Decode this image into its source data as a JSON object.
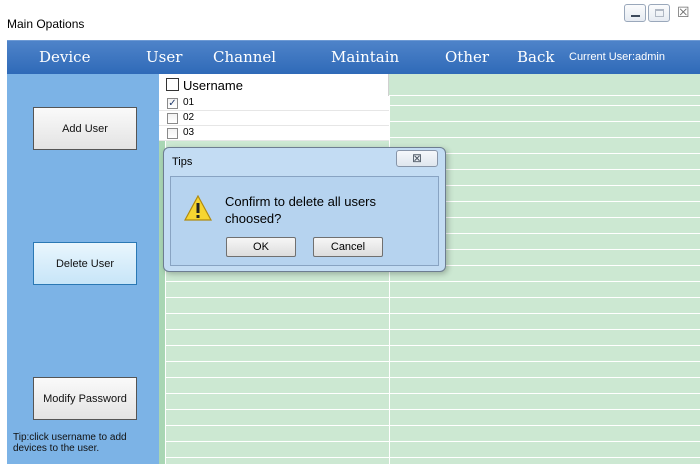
{
  "window": {
    "title": "Main Opations",
    "controls": {
      "minimize": "minimize-icon",
      "maximize": "maximize-icon",
      "close": "close-icon"
    }
  },
  "menu": {
    "items": [
      "Device",
      "User",
      "Channel",
      "Maintain",
      "Other",
      "Back"
    ],
    "current_user": "Current User:admin"
  },
  "sidebar": {
    "buttons": [
      "Add User",
      "Delete User",
      "Modify Password"
    ],
    "active": "Delete User",
    "tip": "Tip:click username to add devices to the user."
  },
  "table": {
    "header": "Username",
    "rows": [
      {
        "name": "01",
        "checked": true
      },
      {
        "name": "02",
        "checked": false
      },
      {
        "name": "03",
        "checked": false
      }
    ]
  },
  "dialog": {
    "title": "Tips",
    "close_glyph": "⊠",
    "message": "Confirm to delete all users choosed?",
    "ok": "OK",
    "cancel": "Cancel",
    "icon": "warning-icon"
  },
  "colors": {
    "menubar": "#2f6ab8",
    "sidebar": "#7cb3e6",
    "grid": "#cce8d2",
    "dialog": "#b6d3ef"
  }
}
